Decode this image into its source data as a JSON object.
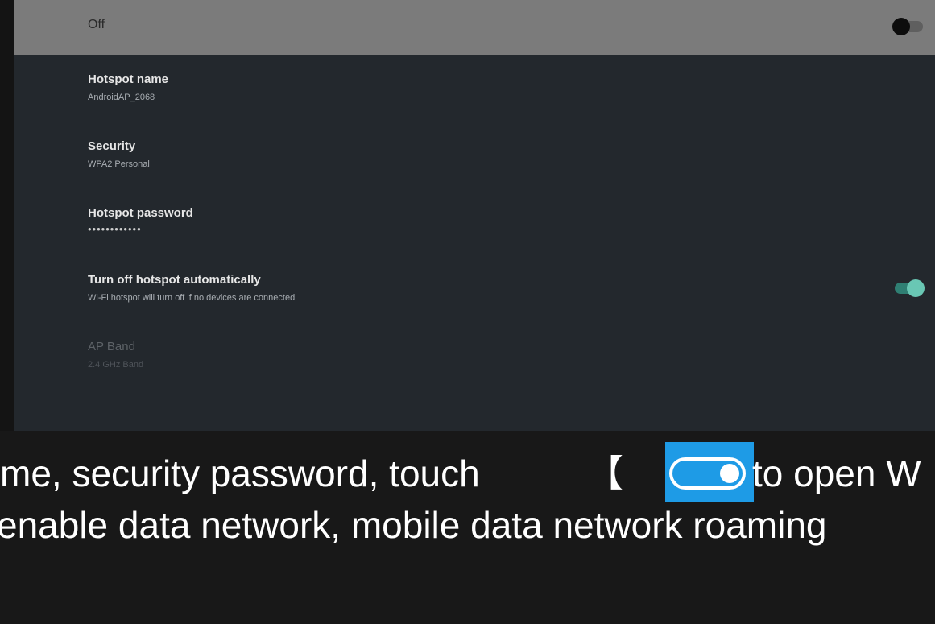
{
  "master": {
    "label": "Off"
  },
  "settings": [
    {
      "title": "Hotspot name",
      "subtitle": "AndroidAP_2068"
    },
    {
      "title": "Security",
      "subtitle": "WPA2 Personal"
    },
    {
      "title": "Hotspot password",
      "subtitle": "••••••••••••"
    },
    {
      "title": "Turn off hotspot automatically",
      "subtitle": "Wi-Fi hotspot will turn off if no devices are connected"
    },
    {
      "title": "AP Band",
      "subtitle": "2.4 GHz Band"
    }
  ],
  "caption": {
    "line1_start": "me, security password, touch",
    "bracket": "【",
    "line1_end": "to open W",
    "line2": "enable data network, mobile data network roaming"
  },
  "colors": {
    "accent": "#69c7b4",
    "highlight": "#1e9be6"
  },
  "icons": [
    "toggle-off-icon",
    "toggle-on-icon",
    "inline-toggle-icon"
  ]
}
